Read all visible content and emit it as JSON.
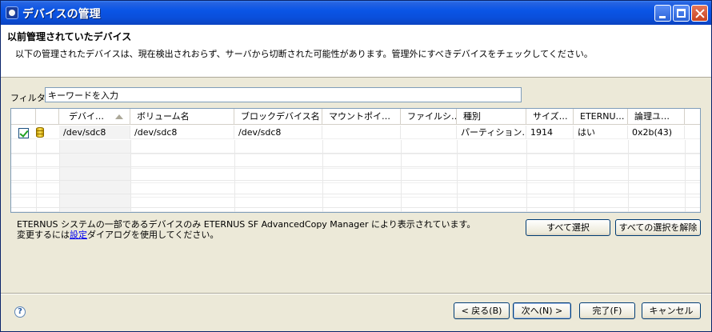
{
  "window": {
    "title": "デバイスの管理"
  },
  "header": {
    "title": "以前管理されていたデバイス",
    "description": "以下の管理されたデバイスは、現在検出されおらず、サーバから切断された可能性があります。管理外にすべきデバイスをチェックしてください。"
  },
  "filter": {
    "label": "フィルタ:",
    "value": "キーワードを入力"
  },
  "table": {
    "columns": [
      "",
      "",
      "デバイ…",
      "ボリューム名",
      "ブロックデバイス名",
      "マウントポイ…",
      "ファイルシ…",
      "種別",
      "サイズ…",
      "ETERNU…",
      "論理ユ…"
    ],
    "sorted_column": "デバイ…",
    "rows": [
      {
        "checked": true,
        "icon": "disk-icon",
        "cells": [
          "/dev/sdc8",
          "/dev/sdc8",
          "/dev/sdc8",
          "",
          "",
          "パーティション…",
          "1914",
          "はい",
          "0x2b(43)"
        ]
      }
    ]
  },
  "note": {
    "line1": "ETERNUS システムの一部であるデバイスのみ ETERNUS SF AdvancedCopy Manager により表示されています。",
    "line2_prefix": "変更するには",
    "line2_link": "設定",
    "line2_suffix": "ダイアログを使用してください。"
  },
  "buttons": {
    "select_all": "すべて選択",
    "deselect_all": "すべての選択を解除",
    "back": "< 戻る(B)",
    "next": "次へ(N) >",
    "finish": "完了(F)",
    "cancel": "キャンセル"
  },
  "help": {
    "glyph": "?"
  }
}
